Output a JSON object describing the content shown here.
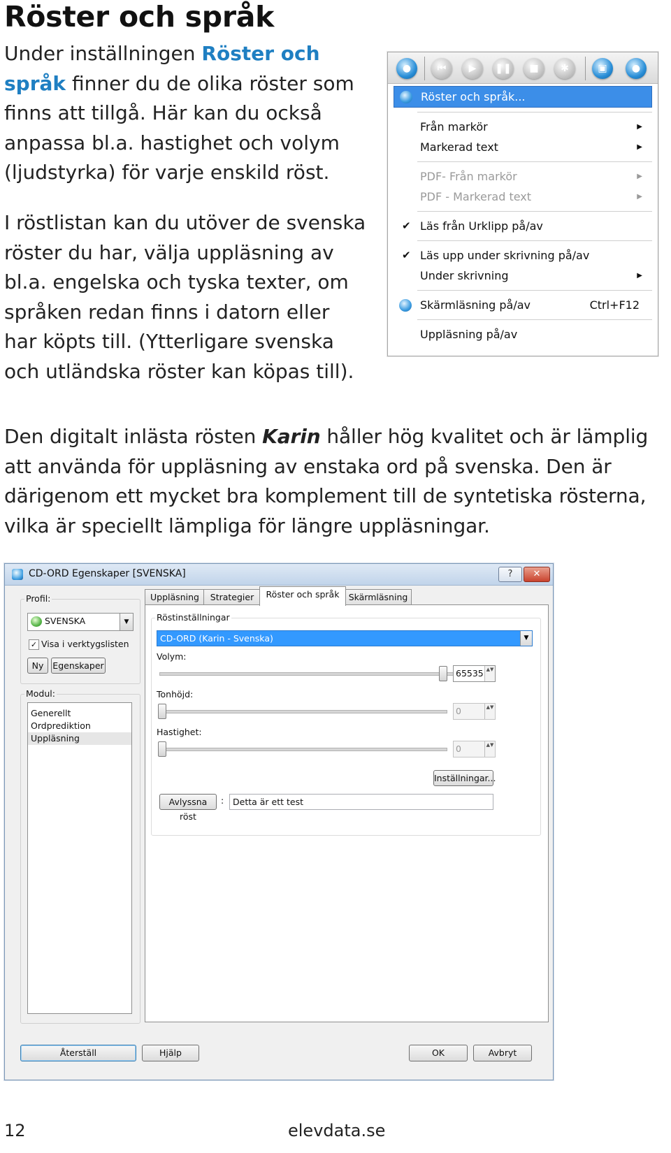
{
  "heading": "Röster och språk",
  "para1": {
    "before": "Under inställningen ",
    "highlight": "Röster och språk",
    "after": " finner du de olika röster som finns att tillgå. Här kan du också anpassa bl.a. hastighet och volym (ljudstyrka) för varje enskild röst."
  },
  "para2": "I röstlistan kan du utöver de svenska röster du har, välja uppläsning av bl.a. engelska och tyska texter, om språken redan finns i datorn eller har köpts till. (Ytterligare svenska och utländska röster kan köpas till).",
  "para3": {
    "before": "Den digitalt inlästa rösten ",
    "emph": "Karin",
    "after": " håller hög kvalitet och är lämplig att använda för uppläsning av enstaka ord på svenska. Den är därigenom ett mycket bra komplement till de syntetiska rösterna, vilka är speciellt lämpliga för längre uppläsningar."
  },
  "menu": {
    "items": [
      {
        "label": "Röster och språk...",
        "selected": true,
        "icon": "voice-settings-icon"
      },
      {
        "label": "Från markör",
        "submenu": true
      },
      {
        "label": "Markerad text",
        "submenu": true
      },
      {
        "label": "PDF- Från markör",
        "submenu": true,
        "disabled": true
      },
      {
        "label": "PDF - Markerad text",
        "submenu": true,
        "disabled": true
      },
      {
        "label": "Läs från Urklipp på/av",
        "checked": true
      },
      {
        "label": "Läs upp under skrivning på/av",
        "checked": true
      },
      {
        "label": "Under skrivning",
        "submenu": true
      },
      {
        "label": "Skärmläsning på/av",
        "shortcut": "Ctrl+F12",
        "icon": "screen-reading-icon"
      },
      {
        "label": "Uppläsning på/av"
      }
    ],
    "toolbar_icons": [
      "speech-icon",
      "skip-back-icon",
      "play-icon",
      "pause-icon",
      "stop-icon",
      "settings-icon",
      "screen-read-icon",
      "record-icon"
    ],
    "check_glyph": "✔",
    "arrow_glyph": "▶"
  },
  "dialog": {
    "title": "CD-ORD Egenskaper [SVENSKA]",
    "help_label": "?",
    "close_label": "✕",
    "profile_label": "Profil:",
    "profile_value": "SVENSKA",
    "show_toolbar_label": "Visa i verktygslisten",
    "show_toolbar_checked": "✓",
    "new_button": "Ny",
    "props_button": "Egenskaper",
    "module_label": "Modul:",
    "modules": [
      "Generellt",
      "Ordprediktion",
      "Uppläsning"
    ],
    "tabs": [
      "Uppläsning",
      "Strategier",
      "Röster och språk",
      "Skärmläsning"
    ],
    "voice_group_label": "Röstinställningar",
    "voice_value": "CD-ORD (Karin - Svenska)",
    "volume_label": "Volym:",
    "volume_value": "65535",
    "volume_level": 1.0,
    "pitch_label": "Tonhöjd:",
    "pitch_value": "0",
    "pitch_level": 0.0,
    "speed_label": "Hastighet:",
    "speed_value": "0",
    "speed_level": 0.0,
    "settings_button": "Inställningar...",
    "listen_button": "Avlyssna röst",
    "listen_colon": ":",
    "test_text": "Detta är ett test",
    "reset_button": "Återställ",
    "help_button": "Hjälp",
    "ok_button": "OK",
    "cancel_button": "Avbryt",
    "spin_glyphs": "▲▼",
    "drop_glyph": "▼"
  },
  "footer": {
    "page_number": "12",
    "site": "elevdata.se"
  }
}
